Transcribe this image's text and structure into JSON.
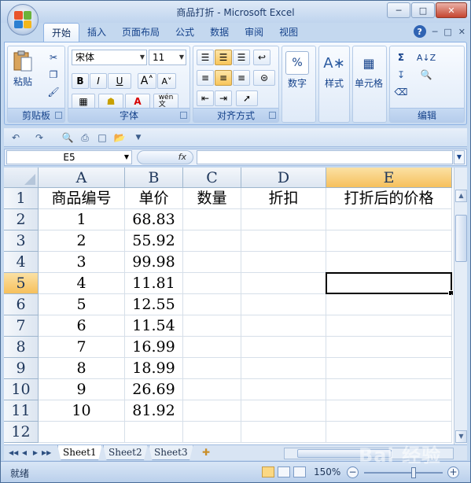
{
  "window": {
    "title": "商品打折 - Microsoft Excel"
  },
  "tabs": [
    "开始",
    "插入",
    "页面布局",
    "公式",
    "数据",
    "审阅",
    "视图"
  ],
  "ribbon": {
    "clipboard": {
      "label": "剪贴板",
      "paste": "粘贴"
    },
    "font": {
      "label": "字体",
      "name": "宋体",
      "size": "11",
      "bold": "B",
      "italic": "I",
      "underline": "U",
      "wen": "wén\n文"
    },
    "alignment": {
      "label": "对齐方式"
    },
    "number": {
      "label": "数字"
    },
    "styles": {
      "label": "样式"
    },
    "cells": {
      "label": "单元格"
    },
    "editing": {
      "label": "编辑"
    }
  },
  "formula_bar": {
    "name_box": "E5",
    "fx": "fx",
    "value": ""
  },
  "grid": {
    "columns": [
      "A",
      "B",
      "C",
      "D",
      "E"
    ],
    "rows": [
      "1",
      "2",
      "3",
      "4",
      "5",
      "6",
      "7",
      "8",
      "9",
      "10",
      "11",
      "12"
    ],
    "selected_cell": "E5",
    "cells": [
      [
        "商品编号",
        "单价",
        "数量",
        "折扣",
        "打折后的价格"
      ],
      [
        "1",
        "68.83",
        "",
        "",
        ""
      ],
      [
        "2",
        "55.92",
        "",
        "",
        ""
      ],
      [
        "3",
        "99.98",
        "",
        "",
        ""
      ],
      [
        "4",
        "11.81",
        "",
        "",
        ""
      ],
      [
        "5",
        "12.55",
        "",
        "",
        ""
      ],
      [
        "6",
        "11.54",
        "",
        "",
        ""
      ],
      [
        "7",
        "16.99",
        "",
        "",
        ""
      ],
      [
        "8",
        "18.99",
        "",
        "",
        ""
      ],
      [
        "9",
        "26.69",
        "",
        "",
        ""
      ],
      [
        "10",
        "81.92",
        "",
        "",
        ""
      ],
      [
        "",
        "",
        "",
        "",
        ""
      ]
    ]
  },
  "sheets": [
    "Sheet1",
    "Sheet2",
    "Sheet3"
  ],
  "active_sheet": "Sheet1",
  "status": {
    "text": "就绪",
    "zoom": "150%"
  },
  "watermark": "Bai 经验"
}
